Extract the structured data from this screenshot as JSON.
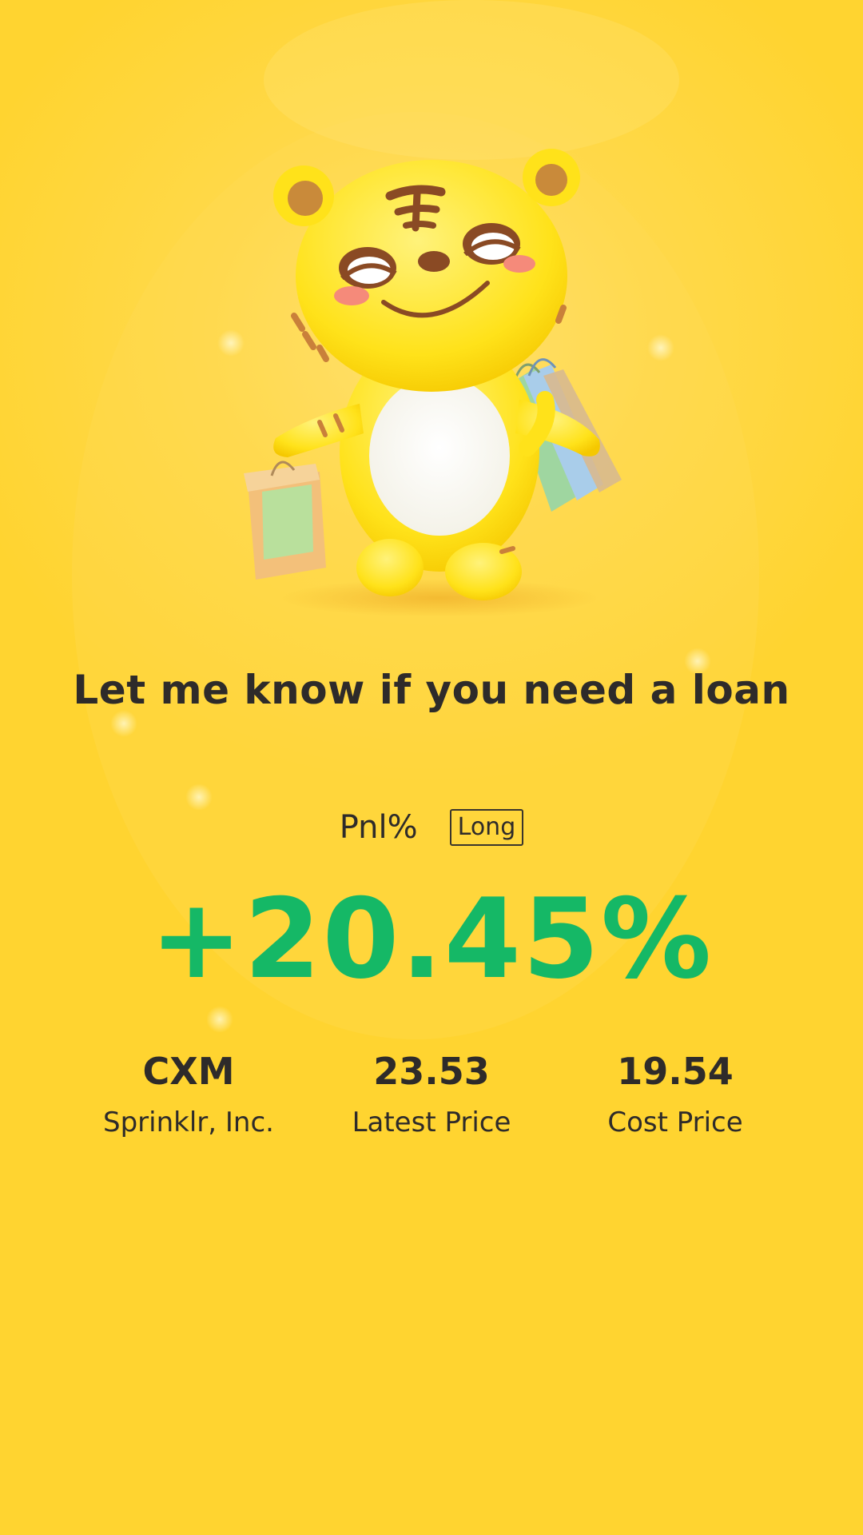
{
  "headline": "Let me know if you need a loan",
  "pnl": {
    "label": "Pnl%",
    "direction": "Long",
    "value": "+20.45%",
    "value_color": "#15b866"
  },
  "stats": [
    {
      "value": "CXM",
      "label": "Sprinklr, Inc."
    },
    {
      "value": "23.53",
      "label": "Latest Price"
    },
    {
      "value": "19.54",
      "label": "Cost Price"
    }
  ],
  "theme": {
    "background": "#ffd430",
    "text": "#2e2b2a"
  },
  "mascot": {
    "icon": "tiger-mascot-with-shopping-bags-icon"
  }
}
